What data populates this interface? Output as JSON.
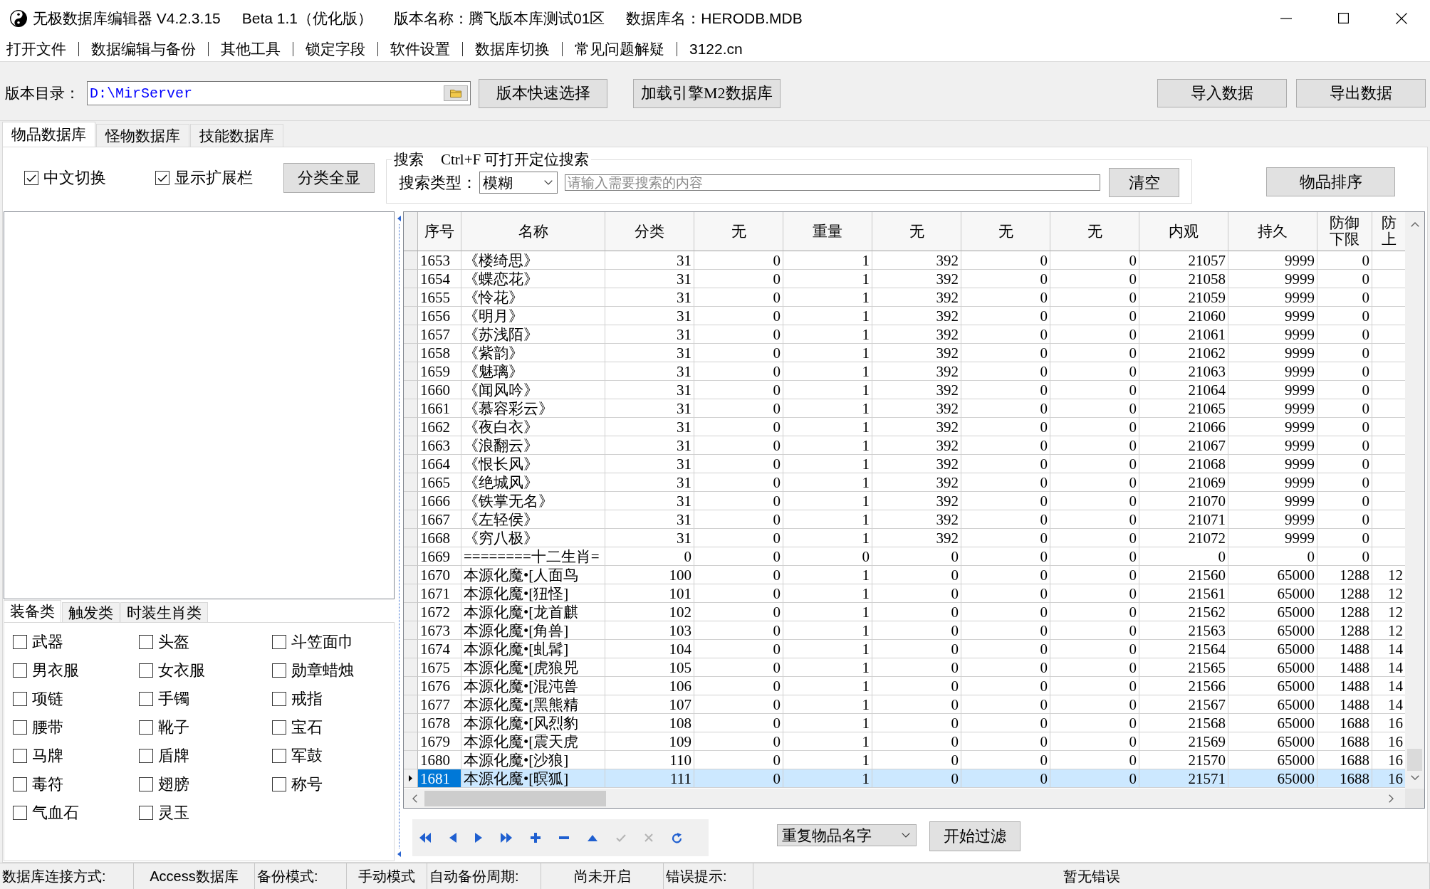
{
  "window": {
    "title_parts": [
      "无极数据库编辑器 V4.2.3.15",
      "Beta 1.1（优化版）",
      "版本名称：腾飞版本库测试01区",
      "数据库名：HERODB.MDB"
    ]
  },
  "menu": [
    "打开文件",
    "数据编辑与备份",
    "其他工具",
    "锁定字段",
    "软件设置",
    "数据库切换",
    "常见问题解疑",
    "3122.cn"
  ],
  "toolbar": {
    "path_label": "版本目录：",
    "path_value": "D:\\MirServer",
    "left_buttons": [
      "版本快速选择",
      "加载引擎M2数据库"
    ],
    "right_buttons": [
      "导入数据",
      "导出数据"
    ]
  },
  "tabs": [
    {
      "label": "物品数据库",
      "selected": true
    },
    {
      "label": "怪物数据库",
      "selected": false
    },
    {
      "label": "技能数据库",
      "selected": false
    }
  ],
  "options": {
    "checkboxes": [
      {
        "label": "中文切换",
        "checked": true
      },
      {
        "label": "显示扩展栏",
        "checked": true
      }
    ],
    "show_all_button": "分类全显",
    "sort_button": "物品排序"
  },
  "search": {
    "legend": "搜索",
    "hint": "Ctrl+F 可打开定位搜索",
    "type_label": "搜索类型：",
    "type_value": "模糊",
    "placeholder": "请输入需要搜索的内容",
    "clear_button": "清空"
  },
  "category_tabs": [
    {
      "label": "装备类",
      "selected": true
    },
    {
      "label": "触发类",
      "selected": false
    },
    {
      "label": "时装生肖类",
      "selected": false
    }
  ],
  "categories": [
    {
      "label": "武器",
      "checked": false
    },
    {
      "label": "头盔",
      "checked": false
    },
    {
      "label": "斗笠面巾",
      "checked": false
    },
    {
      "label": "男衣服",
      "checked": false
    },
    {
      "label": "女衣服",
      "checked": false
    },
    {
      "label": "勋章蜡烛",
      "checked": false
    },
    {
      "label": "项链",
      "checked": false
    },
    {
      "label": "手镯",
      "checked": false
    },
    {
      "label": "戒指",
      "checked": false
    },
    {
      "label": "腰带",
      "checked": false
    },
    {
      "label": "靴子",
      "checked": false
    },
    {
      "label": "宝石",
      "checked": false
    },
    {
      "label": "马牌",
      "checked": false
    },
    {
      "label": "盾牌",
      "checked": false
    },
    {
      "label": "军鼓",
      "checked": false
    },
    {
      "label": "毒符",
      "checked": false
    },
    {
      "label": "翅膀",
      "checked": false
    },
    {
      "label": "称号",
      "checked": false
    },
    {
      "label": "气血石",
      "checked": false
    },
    {
      "label": "灵玉",
      "checked": false
    }
  ],
  "table": {
    "columns": [
      "序号",
      "名称",
      "分类",
      "无",
      "重量",
      "无",
      "无",
      "无",
      "内观",
      "持久",
      "防御下限",
      "防上"
    ],
    "rows": [
      {
        "cells": [
          "1653",
          "《楼绮思》",
          "31",
          "0",
          "1",
          "392",
          "0",
          "0",
          "21057",
          "9999",
          "0"
        ],
        "selected": false
      },
      {
        "cells": [
          "1654",
          "《蝶恋花》",
          "31",
          "0",
          "1",
          "392",
          "0",
          "0",
          "21058",
          "9999",
          "0"
        ],
        "selected": false
      },
      {
        "cells": [
          "1655",
          "《怜花》",
          "31",
          "0",
          "1",
          "392",
          "0",
          "0",
          "21059",
          "9999",
          "0"
        ],
        "selected": false
      },
      {
        "cells": [
          "1656",
          "《明月》",
          "31",
          "0",
          "1",
          "392",
          "0",
          "0",
          "21060",
          "9999",
          "0"
        ],
        "selected": false
      },
      {
        "cells": [
          "1657",
          "《苏浅陌》",
          "31",
          "0",
          "1",
          "392",
          "0",
          "0",
          "21061",
          "9999",
          "0"
        ],
        "selected": false
      },
      {
        "cells": [
          "1658",
          "《紫韵》",
          "31",
          "0",
          "1",
          "392",
          "0",
          "0",
          "21062",
          "9999",
          "0"
        ],
        "selected": false
      },
      {
        "cells": [
          "1659",
          "《魅璃》",
          "31",
          "0",
          "1",
          "392",
          "0",
          "0",
          "21063",
          "9999",
          "0"
        ],
        "selected": false
      },
      {
        "cells": [
          "1660",
          "《闻风吟》",
          "31",
          "0",
          "1",
          "392",
          "0",
          "0",
          "21064",
          "9999",
          "0"
        ],
        "selected": false
      },
      {
        "cells": [
          "1661",
          "《慕容彩云》",
          "31",
          "0",
          "1",
          "392",
          "0",
          "0",
          "21065",
          "9999",
          "0"
        ],
        "selected": false
      },
      {
        "cells": [
          "1662",
          "《夜白衣》",
          "31",
          "0",
          "1",
          "392",
          "0",
          "0",
          "21066",
          "9999",
          "0"
        ],
        "selected": false
      },
      {
        "cells": [
          "1663",
          "《浪翻云》",
          "31",
          "0",
          "1",
          "392",
          "0",
          "0",
          "21067",
          "9999",
          "0"
        ],
        "selected": false
      },
      {
        "cells": [
          "1664",
          "《恨长风》",
          "31",
          "0",
          "1",
          "392",
          "0",
          "0",
          "21068",
          "9999",
          "0"
        ],
        "selected": false
      },
      {
        "cells": [
          "1665",
          "《绝城风》",
          "31",
          "0",
          "1",
          "392",
          "0",
          "0",
          "21069",
          "9999",
          "0"
        ],
        "selected": false
      },
      {
        "cells": [
          "1666",
          "《铁掌无名》",
          "31",
          "0",
          "1",
          "392",
          "0",
          "0",
          "21070",
          "9999",
          "0"
        ],
        "selected": false
      },
      {
        "cells": [
          "1667",
          "《左轻侯》",
          "31",
          "0",
          "1",
          "392",
          "0",
          "0",
          "21071",
          "9999",
          "0"
        ],
        "selected": false
      },
      {
        "cells": [
          "1668",
          "《穷八极》",
          "31",
          "0",
          "1",
          "392",
          "0",
          "0",
          "21072",
          "9999",
          "0"
        ],
        "selected": false
      },
      {
        "cells": [
          "1669",
          "========十二生肖=",
          "0",
          "0",
          "0",
          "0",
          "0",
          "0",
          "0",
          "0",
          "0"
        ],
        "selected": false
      },
      {
        "cells": [
          "1670",
          "本源化魔•[人面鸟",
          "100",
          "0",
          "1",
          "0",
          "0",
          "0",
          "21560",
          "65000",
          "1288",
          "12"
        ],
        "selected": false
      },
      {
        "cells": [
          "1671",
          "本源化魔•[狃怪]",
          "101",
          "0",
          "1",
          "0",
          "0",
          "0",
          "21561",
          "65000",
          "1288",
          "12"
        ],
        "selected": false
      },
      {
        "cells": [
          "1672",
          "本源化魔•[龙首麒",
          "102",
          "0",
          "1",
          "0",
          "0",
          "0",
          "21562",
          "65000",
          "1288",
          "12"
        ],
        "selected": false
      },
      {
        "cells": [
          "1673",
          "本源化魔•[角兽]",
          "103",
          "0",
          "1",
          "0",
          "0",
          "0",
          "21563",
          "65000",
          "1288",
          "12"
        ],
        "selected": false
      },
      {
        "cells": [
          "1674",
          "本源化魔•[虬髯]",
          "104",
          "0",
          "1",
          "0",
          "0",
          "0",
          "21564",
          "65000",
          "1488",
          "14"
        ],
        "selected": false
      },
      {
        "cells": [
          "1675",
          "本源化魔•[虎狼兕",
          "105",
          "0",
          "1",
          "0",
          "0",
          "0",
          "21565",
          "65000",
          "1488",
          "14"
        ],
        "selected": false
      },
      {
        "cells": [
          "1676",
          "本源化魔•[混沌兽",
          "106",
          "0",
          "1",
          "0",
          "0",
          "0",
          "21566",
          "65000",
          "1488",
          "14"
        ],
        "selected": false
      },
      {
        "cells": [
          "1677",
          "本源化魔•[黑熊精",
          "107",
          "0",
          "1",
          "0",
          "0",
          "0",
          "21567",
          "65000",
          "1488",
          "14"
        ],
        "selected": false
      },
      {
        "cells": [
          "1678",
          "本源化魔•[风烈豹",
          "108",
          "0",
          "1",
          "0",
          "0",
          "0",
          "21568",
          "65000",
          "1688",
          "16"
        ],
        "selected": false
      },
      {
        "cells": [
          "1679",
          "本源化魔•[震天虎",
          "109",
          "0",
          "1",
          "0",
          "0",
          "0",
          "21569",
          "65000",
          "1688",
          "16"
        ],
        "selected": false
      },
      {
        "cells": [
          "1680",
          "本源化魔•[沙狼]",
          "110",
          "0",
          "1",
          "0",
          "0",
          "0",
          "21570",
          "65000",
          "1688",
          "16"
        ],
        "selected": false
      },
      {
        "cells": [
          "1681",
          "本源化魔•[暝狐]",
          "111",
          "0",
          "1",
          "0",
          "0",
          "0",
          "21571",
          "65000",
          "1688",
          "16"
        ],
        "selected": true
      }
    ]
  },
  "navigator": {
    "buttons": [
      {
        "kind": "first",
        "disabled": false
      },
      {
        "kind": "prior",
        "disabled": false
      },
      {
        "kind": "next",
        "disabled": false
      },
      {
        "kind": "last",
        "disabled": false
      },
      {
        "kind": "insert",
        "disabled": false
      },
      {
        "kind": "delete",
        "disabled": false
      },
      {
        "kind": "edit",
        "disabled": false
      },
      {
        "kind": "post",
        "disabled": true
      },
      {
        "kind": "cancel",
        "disabled": true
      },
      {
        "kind": "refresh",
        "disabled": false
      }
    ],
    "filter_select": "重复物品名字",
    "filter_button": "开始过滤"
  },
  "status_bar": [
    {
      "label": "数据库连接方式:",
      "value": "Access数据库"
    },
    {
      "label": "备份模式:",
      "value": "手动模式"
    },
    {
      "label": "自动备份周期:",
      "value": "尚未开启"
    },
    {
      "label": "错误提示:",
      "value": "暂无错误"
    }
  ]
}
